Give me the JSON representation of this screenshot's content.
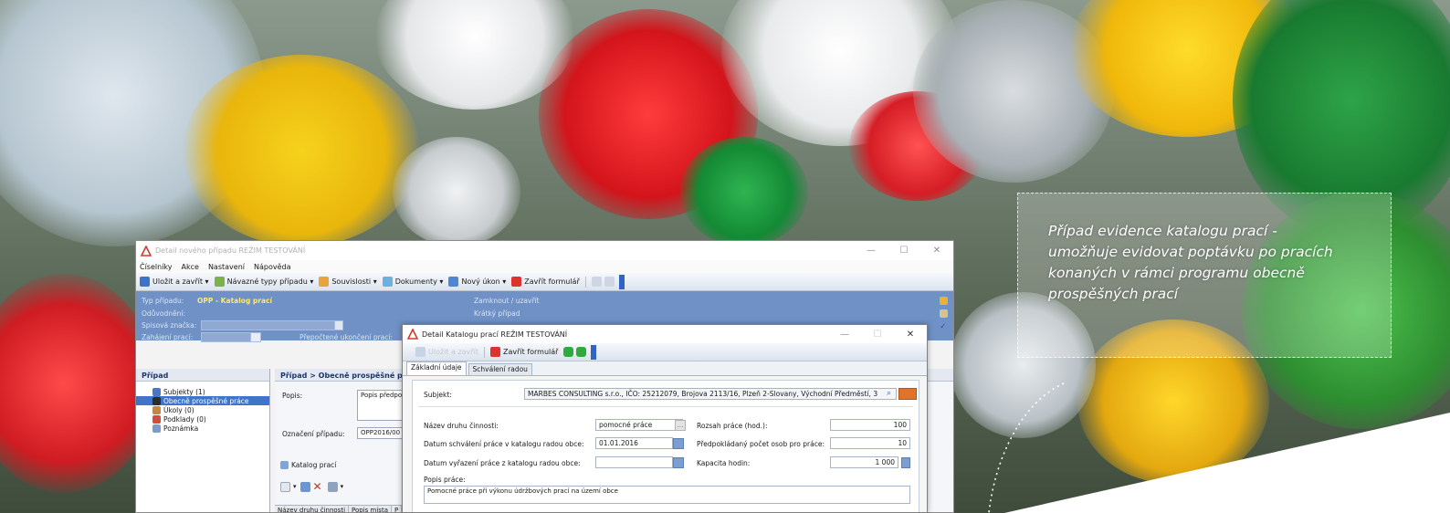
{
  "main_window": {
    "title": "Detail nového případu REŽIM TESTOVÁNÍ",
    "window_controls": [
      "—",
      "☐",
      "✕"
    ],
    "menu": [
      "Číselníky",
      "Akce",
      "Nastavení",
      "Nápověda"
    ],
    "toolbar": {
      "save_close": "Uložit a zavřít",
      "related_types": "Návazné typy případu",
      "links": "Souvislosti",
      "documents": "Dokumenty",
      "new_task": "Nový úkon",
      "close_form": "Zavřít formulář"
    },
    "info": {
      "case_type_label": "Typ případu:",
      "case_type_value": "OPP - Katalog prací",
      "reason_label": "Odůvodnění:",
      "file_mark_label": "Spisová značka:",
      "start_label": "Zahájení prací:",
      "recount_label": "Přepočtené ukončení prací:",
      "locked_label": "Zamknout / uzavřít",
      "short_label": "Krátký případ"
    },
    "tree": {
      "header": "Případ",
      "items": [
        {
          "label": "Subjekty (1)",
          "icon": "users-icon"
        },
        {
          "label": "Obecně prospěšné práce",
          "icon": "tools-icon"
        },
        {
          "label": "Úkoly (0)",
          "icon": "tasks-icon"
        },
        {
          "label": "Podklady (0)",
          "icon": "docs-icon"
        },
        {
          "label": "Poznámka",
          "icon": "note-icon"
        }
      ]
    },
    "content": {
      "breadcrumb": "Případ > Obecně prospěšné p",
      "popis_label": "Popis:",
      "popis_value": "Popis předpo",
      "designation_label": "Označení případu:",
      "designation_value": "OPP2016/00",
      "catalog_label": "Katalog prací",
      "grid_columns": [
        "Název druhu činnosti",
        "Popis místa",
        "P"
      ]
    }
  },
  "dialog": {
    "title": "Detail Katalogu prací REŽIM TESTOVÁNÍ",
    "window_controls": [
      "—",
      "☐",
      "✕"
    ],
    "toolbar": {
      "save_close": "Uložit a zavřít",
      "close_form": "Zavřít formulář"
    },
    "tabs": [
      "Základní údaje",
      "Schválení radou"
    ],
    "fields": {
      "subject_label": "Subjekt:",
      "subject_value": "MARBES CONSULTING s.r.o., IČO: 25212079, Brojova 2113/16, Plzeň 2-Slovany, Východní Předměstí, 3",
      "activity_label": "Název druhu činnosti:",
      "activity_value": "pomocné práce",
      "range_label": "Rozsah práce (hod.):",
      "range_value": "100",
      "approval_date_label": "Datum schválení práce v katalogu radou obce:",
      "approval_date_value": "01.01.2016",
      "persons_label": "Předpokládaný počet osob pro práce:",
      "persons_value": "10",
      "removal_date_label": "Datum vyřazení práce z katalogu radou obce:",
      "removal_date_value": "",
      "capacity_label": "Kapacita hodin:",
      "capacity_value": "1 000",
      "description_label": "Popis práce:",
      "description_value": "Pomocné práce při výkonu údržbových prací na území obce"
    }
  },
  "callout": {
    "text": "Případ evidence katalogu prací - umožňuje evidovat poptávku po pracích konaných v rámci programu obecně prospěšných prací"
  }
}
